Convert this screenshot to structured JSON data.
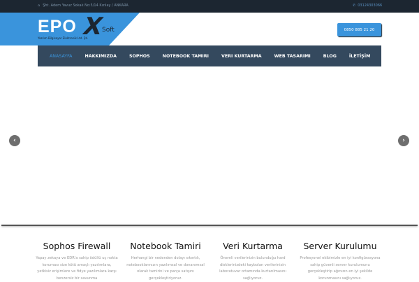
{
  "topbar": {
    "address": "Şht. Adem Yavuz Sokak No:5/14 Kızılay / ANKARA",
    "phone": "03124303066"
  },
  "logo": {
    "main": "EPO",
    "x": "X",
    "soft": "Soft",
    "subtitle": "Yazılım Bilgisayar Elektronik Ltd. Şti."
  },
  "header": {
    "phone_button": "0850 885 21 20"
  },
  "nav": [
    "ANASAYFA",
    "HAKKIMIZDA",
    "SOPHOS",
    "NOTEBOOK TAMIRI",
    "VERI KURTARMA",
    "WEB TASARIMI",
    "BLOG",
    "İLETİŞİM"
  ],
  "slider": {
    "prev": "‹",
    "next": "›"
  },
  "services": [
    {
      "title": "Sophos Firewall",
      "text": "Yapay zekaya ve EDR'a sahip ödüllü uç nokta koruması size kötü amaçlı yazılımlara, yetkisiz erişimlere ve fidye yazılımlara karşı benzersiz bir savunma"
    },
    {
      "title": "Notebook Tamiri",
      "text": "Herhangi bir nedenden dolayı sıkıntılı, notebooklarınızın yazılımsal ve donanımsal olarak tamirini ve parça satışını gerçekleştiriyoruz."
    },
    {
      "title": "Veri Kurtarma",
      "text": "Önemli verilerinizin bulunduğu hard disklerinizdeki kaybolan verilerinizin laboratuvar ortamında kurtarılmasını sağlıyoruz."
    },
    {
      "title": "Server Kurulumu",
      "text": "Profesyonel ekibimizle en iyi konfigürasyona sahip güvenli server kurulumunu gerçekleştirip ağınızın en iyi şekilde korunmasını sağlıyoruz."
    }
  ]
}
